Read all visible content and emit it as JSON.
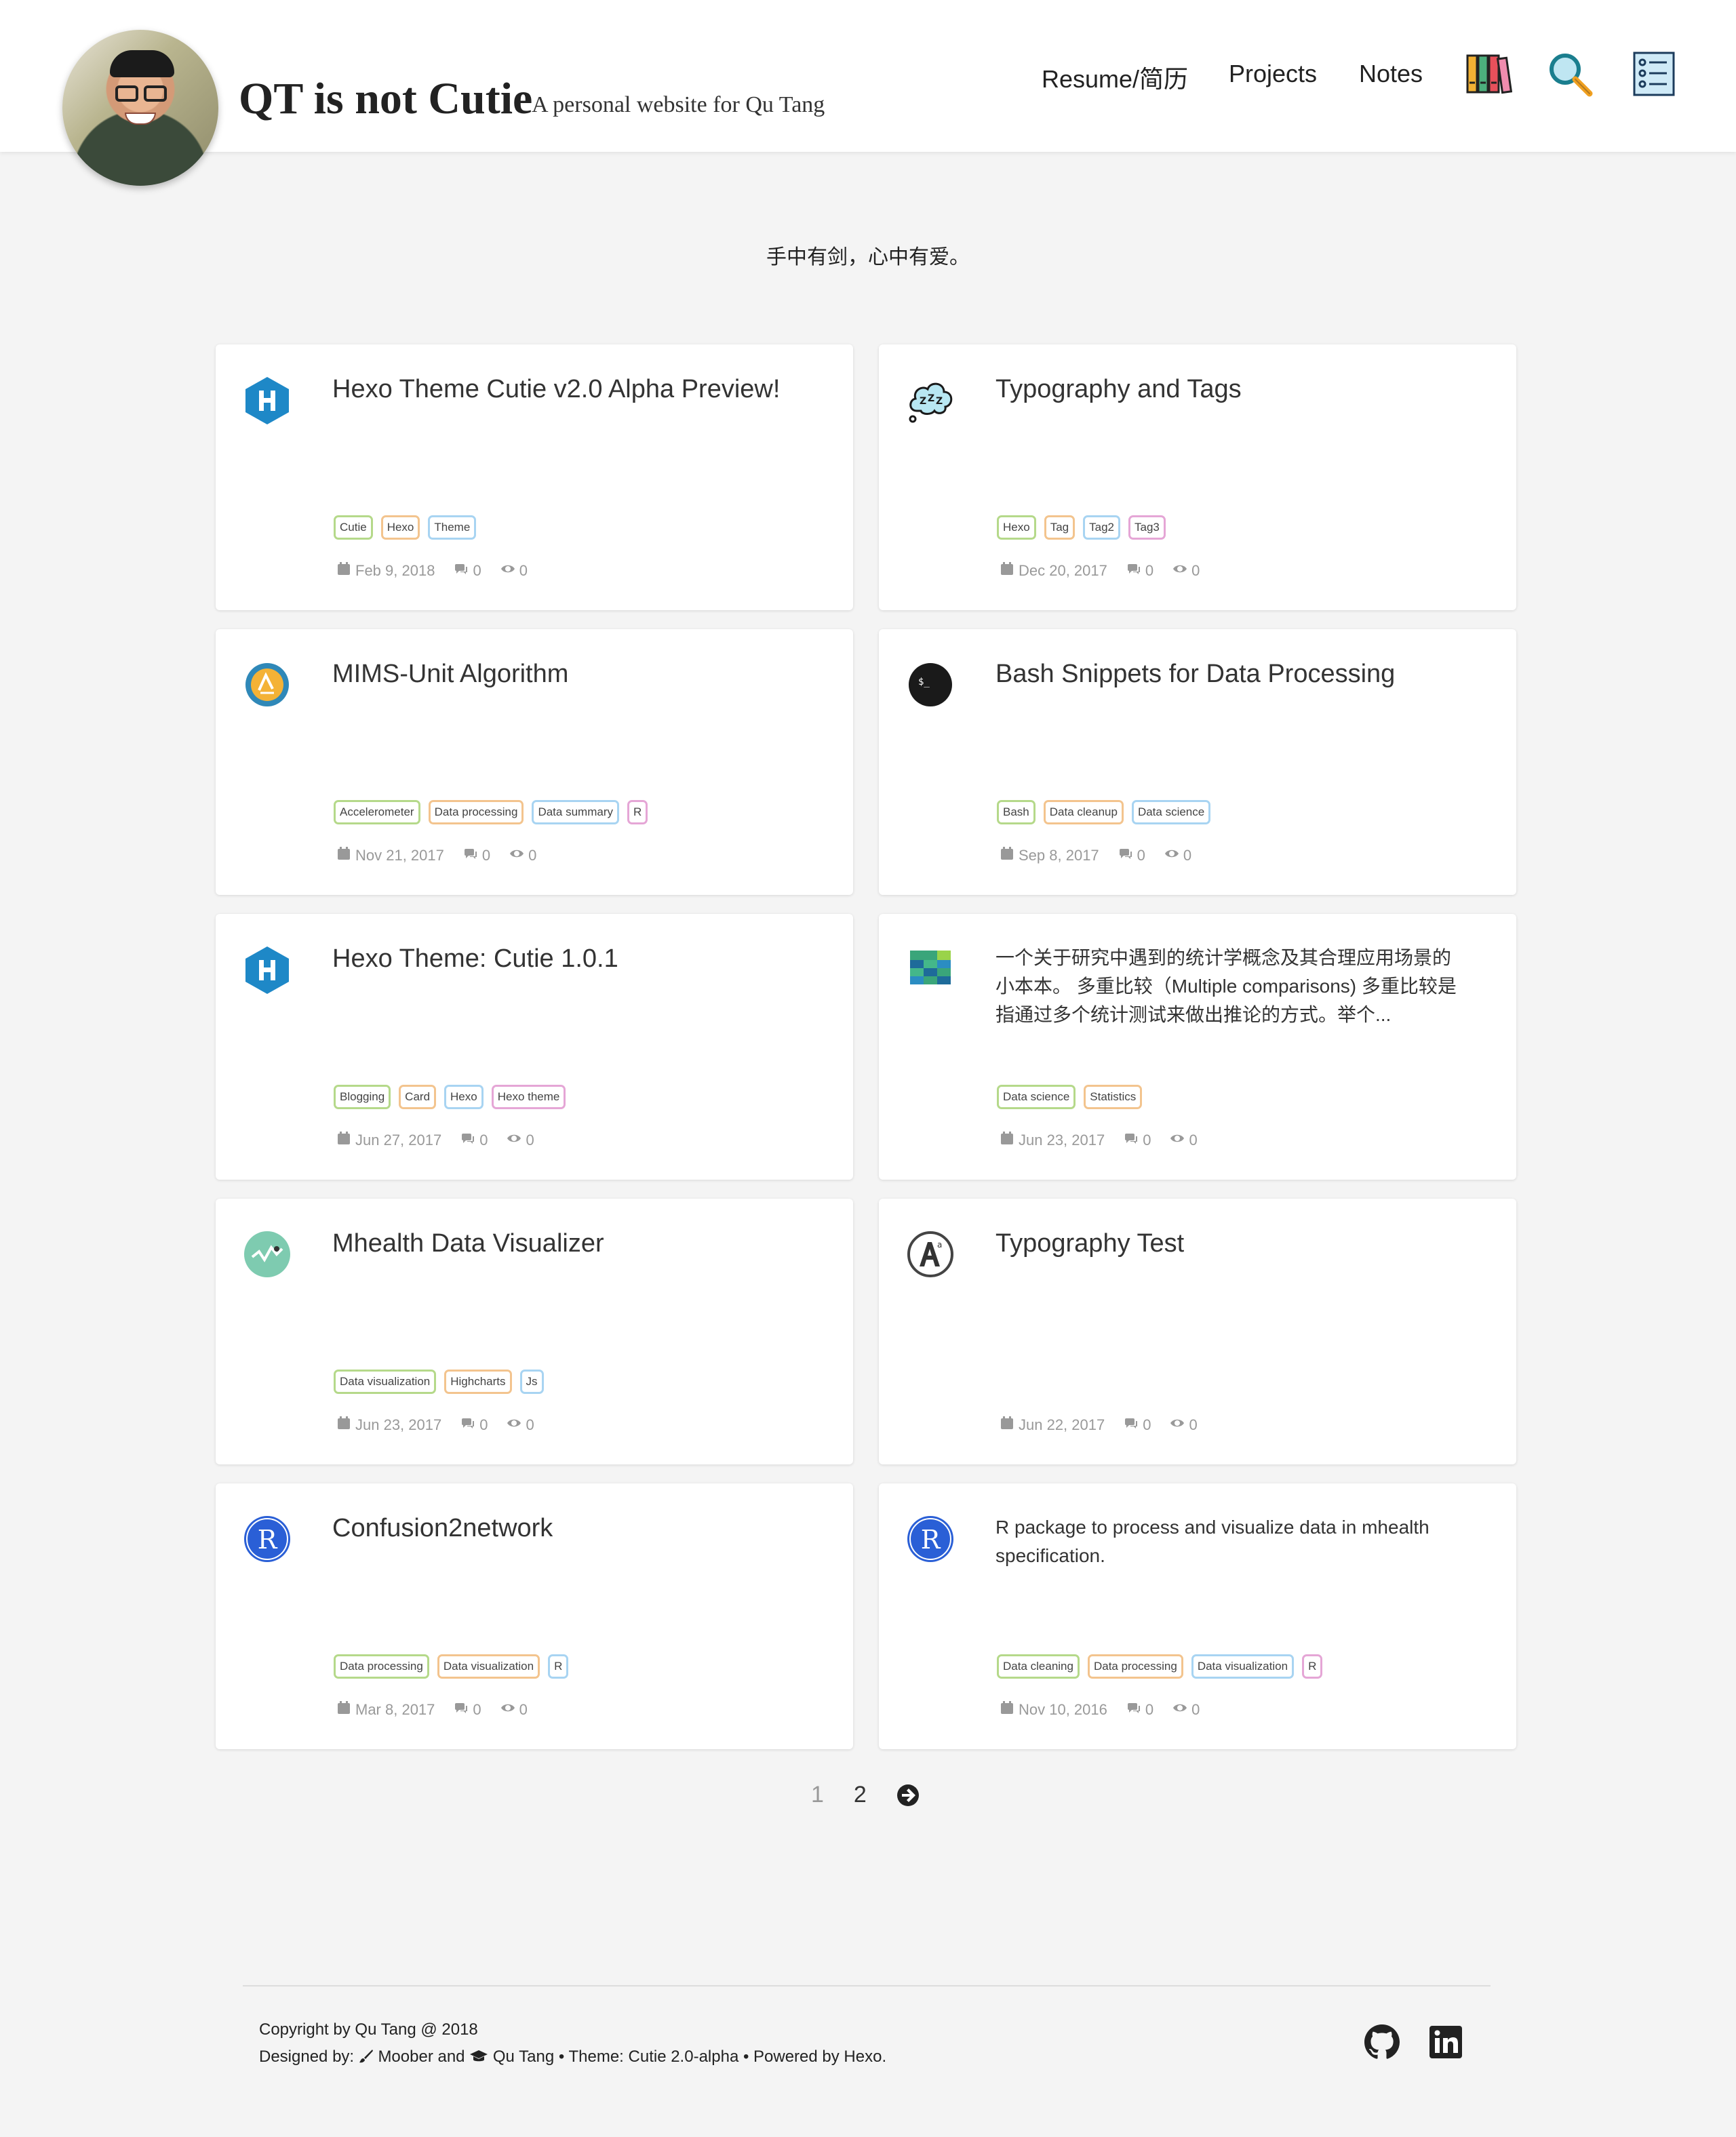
{
  "header": {
    "title": "QT is not Cutie",
    "subtitle": "A personal website for Qu Tang",
    "nav": {
      "resume": "Resume/简历",
      "projects": "Projects",
      "notes": "Notes"
    },
    "icons": [
      "books-icon",
      "search-icon",
      "list-icon"
    ]
  },
  "motto": "手中有剑，心中有爱。",
  "posts": [
    {
      "title": "Hexo Theme Cutie v2.0 Alpha Preview!",
      "icon": "hexo-icon",
      "tags": [
        "Cutie",
        "Hexo",
        "Theme"
      ],
      "date": "Feb 9, 2018",
      "comments": "0",
      "views": "0"
    },
    {
      "title": "Typography and Tags",
      "icon": "sleep-cloud-icon",
      "tags": [
        "Hexo",
        "Tag",
        "Tag2",
        "Tag3"
      ],
      "date": "Dec 20, 2017",
      "comments": "0",
      "views": "0"
    },
    {
      "title": "MIMS-Unit Algorithm",
      "icon": "mims-icon",
      "tags": [
        "Accelerometer",
        "Data processing",
        "Data summary",
        "R"
      ],
      "date": "Nov 21, 2017",
      "comments": "0",
      "views": "0"
    },
    {
      "title": "Bash Snippets for Data Processing",
      "icon": "terminal-icon",
      "tags": [
        "Bash",
        "Data cleanup",
        "Data science"
      ],
      "date": "Sep 8, 2017",
      "comments": "0",
      "views": "0"
    },
    {
      "title": "Hexo Theme: Cutie 1.0.1",
      "icon": "hexo-icon",
      "tags": [
        "Blogging",
        "Card",
        "Hexo",
        "Hexo theme"
      ],
      "date": "Jun 27, 2017",
      "comments": "0",
      "views": "0"
    },
    {
      "excerpt": "一个关于研究中遇到的统计学概念及其合理应用场景的小本本。 多重比较（Multiple comparisons) 多重比较是指通过多个统计测试来做出推论的方式。举个...",
      "icon": "stats-grid-icon",
      "tags": [
        "Data science",
        "Statistics"
      ],
      "date": "Jun 23, 2017",
      "comments": "0",
      "views": "0"
    },
    {
      "title": "Mhealth Data Visualizer",
      "icon": "line-chart-icon",
      "tags": [
        "Data visualization",
        "Highcharts",
        "Js"
      ],
      "date": "Jun 23, 2017",
      "comments": "0",
      "views": "0"
    },
    {
      "title": "Typography Test",
      "icon": "typography-icon",
      "tags": [],
      "date": "Jun 22, 2017",
      "comments": "0",
      "views": "0"
    },
    {
      "title": "Confusion2network",
      "icon": "r-icon",
      "tags": [
        "Data processing",
        "Data visualization",
        "R"
      ],
      "date": "Mar 8, 2017",
      "comments": "0",
      "views": "0"
    },
    {
      "excerpt": "R package to process and visualize data in mhealth specification.",
      "icon": "r-icon",
      "tags": [
        "Data cleaning",
        "Data processing",
        "Data visualization",
        "R"
      ],
      "date": "Nov 10, 2016",
      "comments": "0",
      "views": "0"
    }
  ],
  "pagination": {
    "current": "1",
    "next_page": "2",
    "next_icon": "arrow-right-circle-icon"
  },
  "footer": {
    "copyright": "Copyright by Qu Tang @ 2018",
    "designed_by_label": "Designed by:",
    "designer1": "Moober",
    "and": "and",
    "designer2": "Qu Tang",
    "theme": "• Theme: Cutie 2.0-alpha • Powered by Hexo.",
    "social": [
      "github-icon",
      "linkedin-icon"
    ]
  },
  "colors": {
    "tag_green": "#b5d98a",
    "tag_orange": "#f3c48e",
    "tag_blue": "#a8d4f2",
    "tag_pink": "#e5a6d6",
    "hexo_blue": "#1e88c7",
    "r_blue": "#2a5fd6"
  }
}
